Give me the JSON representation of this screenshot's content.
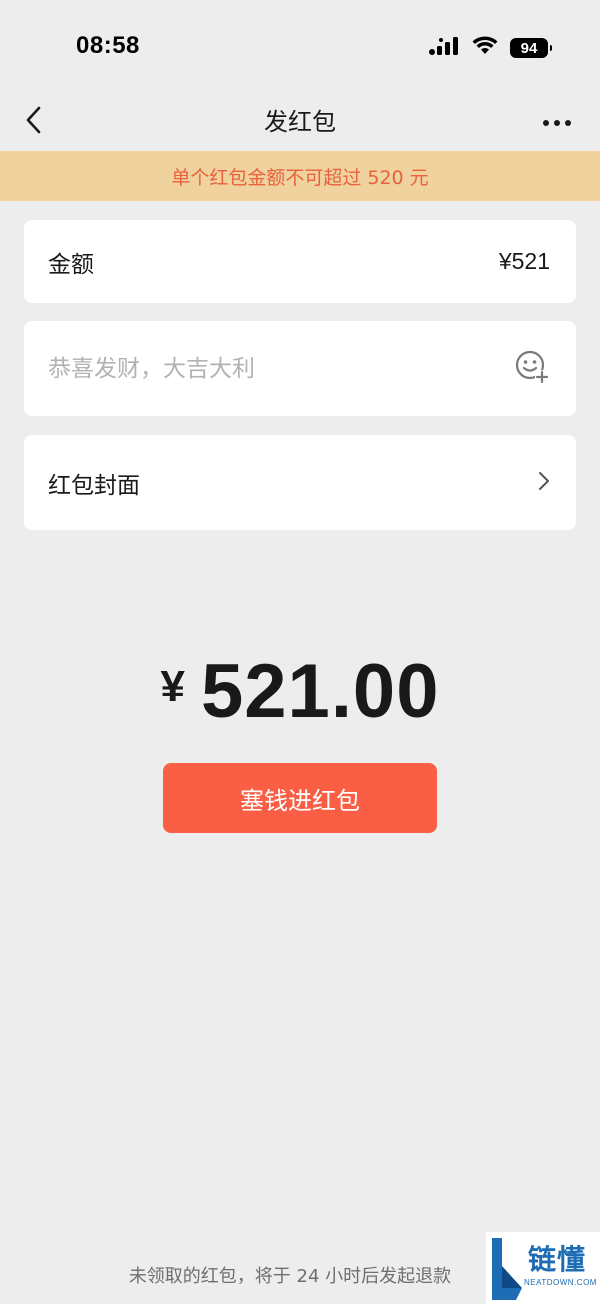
{
  "status_bar": {
    "time": "08:58",
    "battery": "94",
    "icons": [
      "signal-icon",
      "wifi-icon",
      "battery-icon"
    ]
  },
  "nav": {
    "title": "发红包",
    "back_icon": "chevron-left-icon",
    "more_icon": "more-dots-icon"
  },
  "warning": "单个红包金额不可超过 520 元",
  "amount_row": {
    "label": "金额",
    "value": "¥521"
  },
  "greeting_row": {
    "placeholder": "恭喜发财，大吉大利",
    "icon": "emoji-add-icon"
  },
  "cover_row": {
    "label": "红包封面",
    "icon": "chevron-right-icon"
  },
  "total": {
    "currency": "¥",
    "amount": "521.00"
  },
  "primary_button": "塞钱进红包",
  "footer_note": "未领取的红包，将于 24 小时后发起退款",
  "watermark": {
    "text": "链懂",
    "sub": "NEATDOWN.COM"
  },
  "colors": {
    "background": "#ededed",
    "banner_bg": "#efd29e",
    "banner_text": "#e8623c",
    "primary_button": "#fa5f45"
  }
}
